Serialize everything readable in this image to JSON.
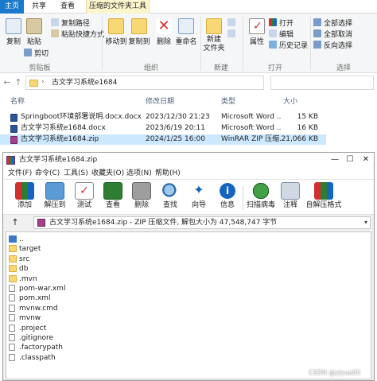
{
  "explorer": {
    "tabs": [
      "主页",
      "共享",
      "查看",
      "压缩的文件夹工具"
    ],
    "ribbon": {
      "clipboard": {
        "label": "剪贴板",
        "copy": "复制",
        "paste": "粘贴",
        "copy_path": "复制路径",
        "paste_shortcut": "粘贴快捷方式",
        "cut": "剪切"
      },
      "organize": {
        "label": "组织",
        "move_to": "移动到",
        "copy_to": "复制到",
        "delete": "删除",
        "rename": "重命名"
      },
      "new": {
        "label": "新建",
        "new_folder": "新建\n文件夹"
      },
      "open": {
        "label": "打开",
        "properties": "属性",
        "open": "打开",
        "edit": "编辑",
        "history": "历史记录"
      },
      "select": {
        "label": "选择",
        "select_all": "全部选择",
        "select_none": "全部取消",
        "invert": "反向选择"
      }
    },
    "address": {
      "separator": "›",
      "path": "古文学习系统e1684",
      "back": "←",
      "forward": "→",
      "dropdown": "⌄",
      "up": "↑"
    },
    "columns": {
      "name": "名称",
      "modified": "修改日期",
      "type": "类型",
      "size": "大小"
    },
    "files": [
      {
        "name": "Springboot环境部署说明.docx.docx",
        "modified": "2023/12/30 21:23",
        "type": "Microsoft Word ...",
        "size": "15 KB",
        "kind": "docx"
      },
      {
        "name": "古文学习系统e1684.docx",
        "modified": "2023/6/19 20:11",
        "type": "Microsoft Word ...",
        "size": "16 KB",
        "kind": "docx"
      },
      {
        "name": "古文学习系统e1684.zip",
        "modified": "2024/1/25 16:00",
        "type": "WinRAR ZIP 压缩...",
        "size": "21,066 KB",
        "kind": "zip"
      }
    ]
  },
  "rar": {
    "title": "古文学习系统e1684.zip",
    "controls": {
      "minimize": "—",
      "maximize": "☐",
      "close": "✕"
    },
    "menu": [
      "文件(F)",
      "命令(C)",
      "工具(S)",
      "收藏夹(O)",
      "选项(N)",
      "帮助(H)"
    ],
    "toolbar": [
      "添加",
      "解压到",
      "测试",
      "查看",
      "删除",
      "查找",
      "向导",
      "信息",
      "扫描病毒",
      "注释",
      "自解压格式"
    ],
    "path": "古文学习系统e1684.zip - ZIP 压缩文件, 解包大小为 47,548,747 字节",
    "up": "↑",
    "dropdown": "▾",
    "items": [
      {
        "name": "..",
        "kind": "up"
      },
      {
        "name": "target",
        "kind": "folder"
      },
      {
        "name": "src",
        "kind": "folder"
      },
      {
        "name": "db",
        "kind": "folder"
      },
      {
        "name": ".mvn",
        "kind": "folder"
      },
      {
        "name": "pom-war.xml",
        "kind": "file"
      },
      {
        "name": "pom.xml",
        "kind": "file"
      },
      {
        "name": "mvnw.cmd",
        "kind": "file"
      },
      {
        "name": "mvnw",
        "kind": "file"
      },
      {
        "name": ".project",
        "kind": "file"
      },
      {
        "name": ".gitignore",
        "kind": "file"
      },
      {
        "name": ".factorypath",
        "kind": "file"
      },
      {
        "name": ".classpath",
        "kind": "file"
      }
    ]
  },
  "watermark": "CSDN @yiyue05",
  "colors": {
    "accent": "#1979ca",
    "selection": "#cce8ff",
    "tools_tab": "#fdf6cc"
  }
}
